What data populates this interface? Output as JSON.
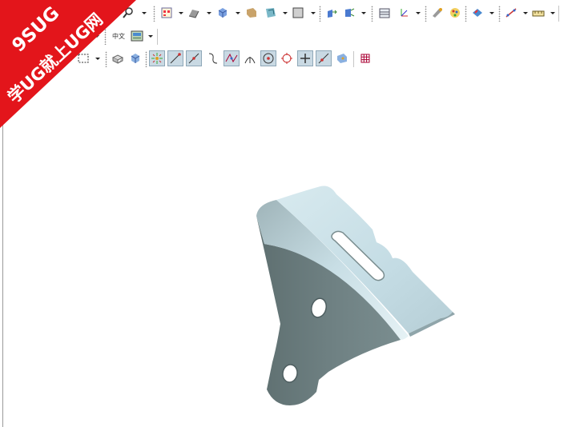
{
  "watermark": {
    "site": "9SUG",
    "slogan": "学UG就上UG网",
    "color": "#e3151b"
  },
  "toolbar": {
    "label_chinese_small": "中文",
    "accent": "#c9d9e3"
  },
  "part": {
    "face_light": "#c9e0e8",
    "face_dark": "#6e8082"
  }
}
